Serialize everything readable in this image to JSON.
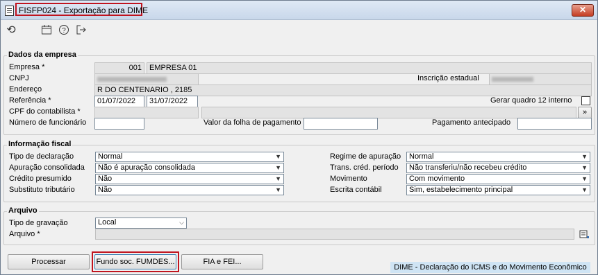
{
  "window": {
    "title": "FISFP024 - Exportação para DIME",
    "close_glyph": "✕"
  },
  "toolbar": {
    "icons": [
      "undo-icon",
      "calendar-icon",
      "help-icon",
      "exit-icon"
    ]
  },
  "dados": {
    "legend": "Dados da empresa",
    "empresa_label": "Empresa *",
    "empresa_code": "001",
    "empresa_name": "EMPRESA 01",
    "cnpj_label": "CNPJ",
    "ie_label": "Inscrição estadual",
    "endereco_label": "Endereço",
    "endereco_value": "R DO CENTENARIO , 2185",
    "referencia_label": "Referência *",
    "ref_start": "01/07/2022",
    "ref_end": "31/07/2022",
    "gerar_label": "Gerar quadro 12 interno",
    "cpf_label": "CPF do contabilista *",
    "cpf_btn": "»",
    "func_label": "Número de funcionário",
    "folha_label": "Valor da folha de pagamento",
    "antecipado_label": "Pagamento antecipado"
  },
  "fiscal": {
    "legend": "Informação fiscal",
    "tipo_decl_label": "Tipo de declaração",
    "tipo_decl_value": "Normal",
    "apur_label": "Apuração consolidada",
    "apur_value": "Não é apuração consolidada",
    "credito_label": "Crédito presumido",
    "credito_value": "Não",
    "subst_label": "Substituto tributário",
    "subst_value": "Não",
    "regime_label": "Regime de apuração",
    "regime_value": "Normal",
    "trans_label": "Trans. créd. período",
    "trans_value": "Não transferiu/não recebeu crédito",
    "mov_label": "Movimento",
    "mov_value": "Com movimento",
    "escrita_label": "Escrita contábil",
    "escrita_value": "Sim, estabelecimento principal"
  },
  "arquivo": {
    "legend": "Arquivo",
    "tipo_label": "Tipo de gravação",
    "tipo_value": "Local",
    "arquivo_label": "Arquivo *"
  },
  "buttons": {
    "processar": "Processar",
    "fundo": "Fundo soc. FUMDES...",
    "fia": "FIA e FEI..."
  },
  "status": "DIME - Declaração do ICMS e do Movimento Econômico"
}
